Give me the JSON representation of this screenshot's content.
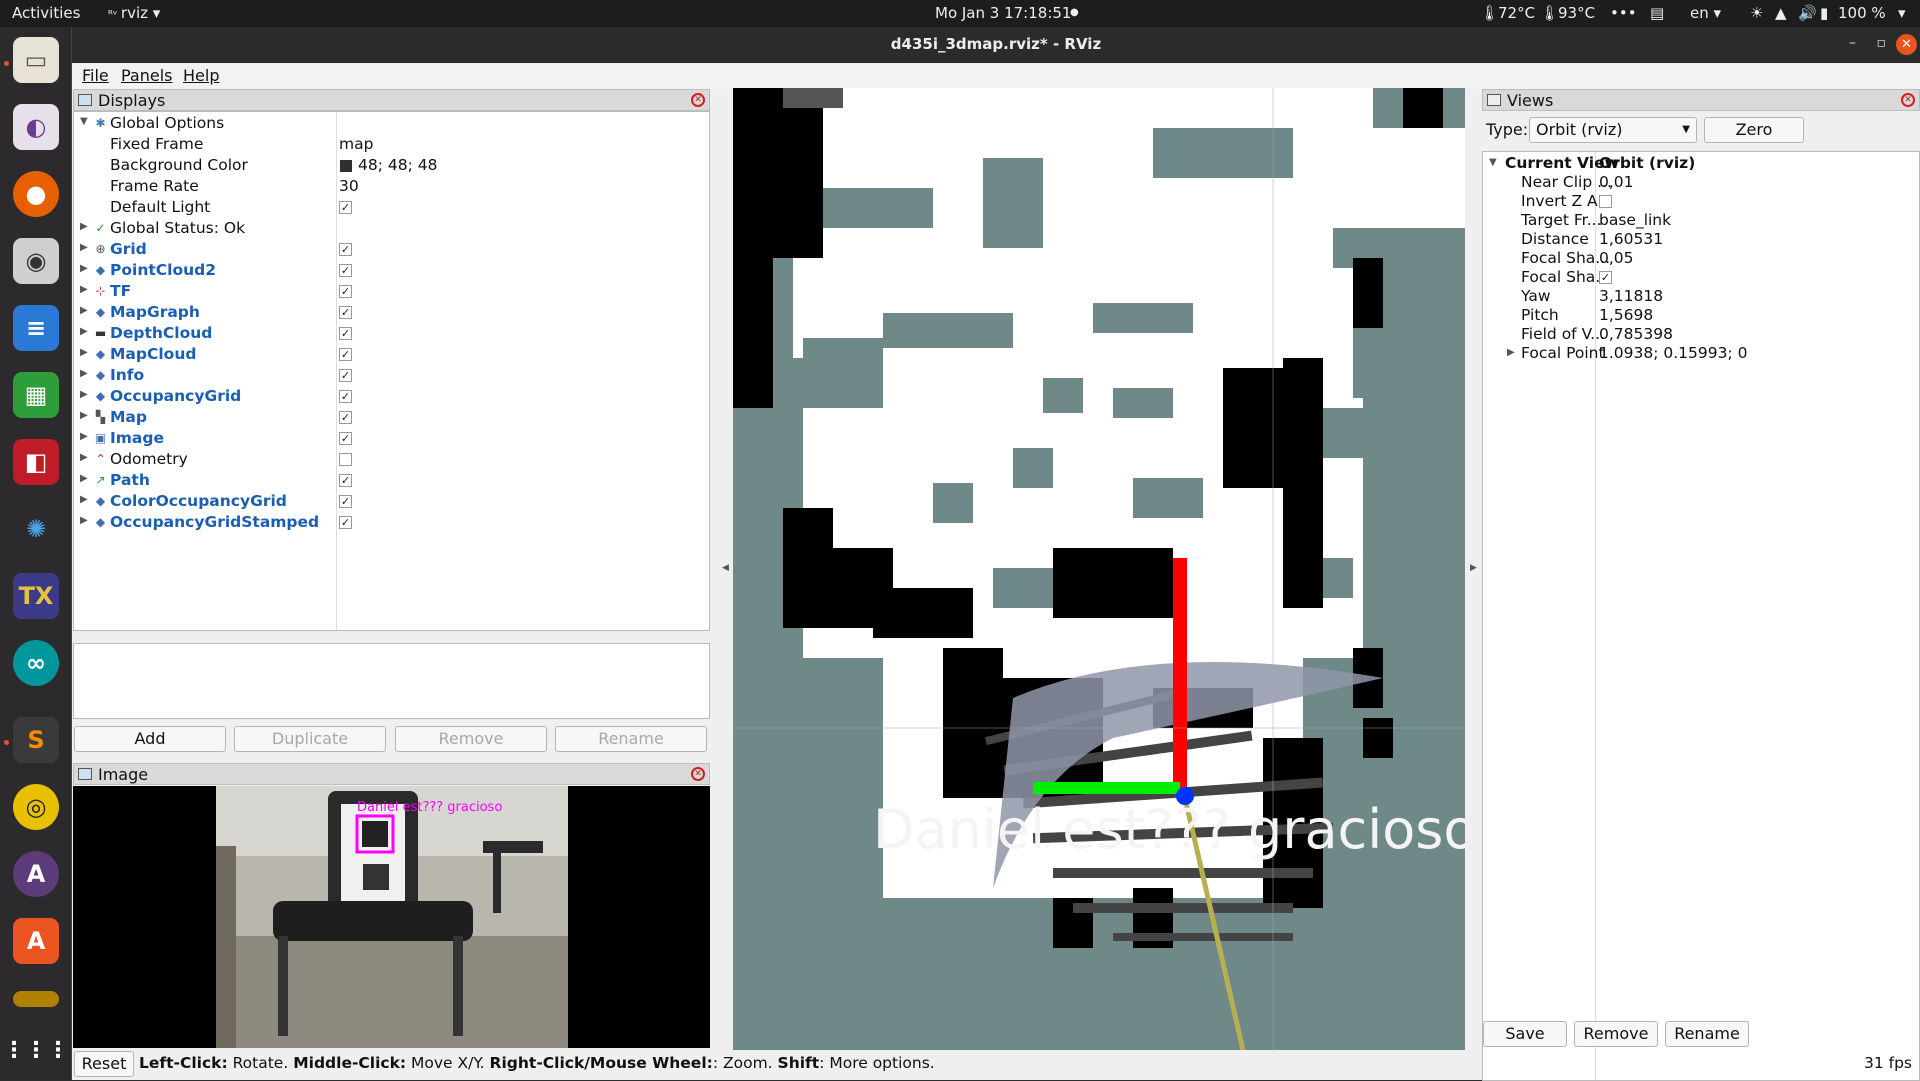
{
  "topbar": {
    "activities": "Activities",
    "app_name": "rviz",
    "clock": "Mo Jan 3  17:18:51",
    "temp1": "72°C",
    "temp2": "93°C",
    "lang": "en",
    "battery": "100 %"
  },
  "window": {
    "title": "d435i_3dmap.rviz* - RViz"
  },
  "menu": [
    "File",
    "Panels",
    "Help"
  ],
  "displays_panel": {
    "title": "Displays",
    "global_options": "Global Options",
    "options": [
      {
        "name": "Fixed Frame",
        "value": "map"
      },
      {
        "name": "Background Color",
        "value": "48; 48; 48"
      },
      {
        "name": "Frame Rate",
        "value": "30"
      },
      {
        "name": "Default Light",
        "value": "✓"
      }
    ],
    "global_status": "Global Status: Ok",
    "items": [
      {
        "name": "Grid",
        "checked": "✓"
      },
      {
        "name": "PointCloud2",
        "checked": "✓"
      },
      {
        "name": "TF",
        "checked": "✓"
      },
      {
        "name": "MapGraph",
        "checked": "✓"
      },
      {
        "name": "DepthCloud",
        "checked": "✓"
      },
      {
        "name": "MapCloud",
        "checked": "✓"
      },
      {
        "name": "Info",
        "checked": "✓"
      },
      {
        "name": "OccupancyGrid",
        "checked": "✓"
      },
      {
        "name": "Map",
        "checked": "✓"
      },
      {
        "name": "Image",
        "checked": "✓"
      },
      {
        "name": "Odometry",
        "checked": ""
      },
      {
        "name": "Path",
        "checked": "✓"
      },
      {
        "name": "ColorOccupancyGrid",
        "checked": "✓"
      },
      {
        "name": "OccupancyGridStamped",
        "checked": "✓"
      }
    ],
    "buttons": {
      "add": "Add",
      "duplicate": "Duplicate",
      "remove": "Remove",
      "rename": "Rename"
    }
  },
  "image_panel": {
    "title": "Image",
    "overlay_text": "Daniel est??? gracioso"
  },
  "viewport": {
    "overlay_text": "Daniel est??? gracioso"
  },
  "views_panel": {
    "title": "Views",
    "type_label": "Type:",
    "type_value": "Orbit (rviz)",
    "zero": "Zero",
    "current_view": "Current View",
    "current_view_value": "Orbit (rviz)",
    "props": [
      {
        "name": "Near Clip ...",
        "value": "0,01"
      },
      {
        "name": "Invert Z A...",
        "value": ""
      },
      {
        "name": "Target Fr...",
        "value": "base_link"
      },
      {
        "name": "Distance",
        "value": "1,60531"
      },
      {
        "name": "Focal Sha...",
        "value": "0,05"
      },
      {
        "name": "Focal Sha...",
        "value": "✓"
      },
      {
        "name": "Yaw",
        "value": "3,11818"
      },
      {
        "name": "Pitch",
        "value": "1,5698"
      },
      {
        "name": "Field of V...",
        "value": "0,785398"
      },
      {
        "name": "Focal Point",
        "value": "1.0938; 0.15993; 0"
      }
    ],
    "buttons": {
      "save": "Save",
      "remove": "Remove",
      "rename": "Rename"
    }
  },
  "statusbar": {
    "reset": "Reset",
    "b1": "Left-Click:",
    "t1": " Rotate. ",
    "b2": "Middle-Click:",
    "t2": " Move X/Y. ",
    "b3": "Right-Click/Mouse Wheel:",
    "t3": ": Zoom. ",
    "b4": "Shift",
    "t4": ": More options.",
    "fps": "31 fps"
  }
}
